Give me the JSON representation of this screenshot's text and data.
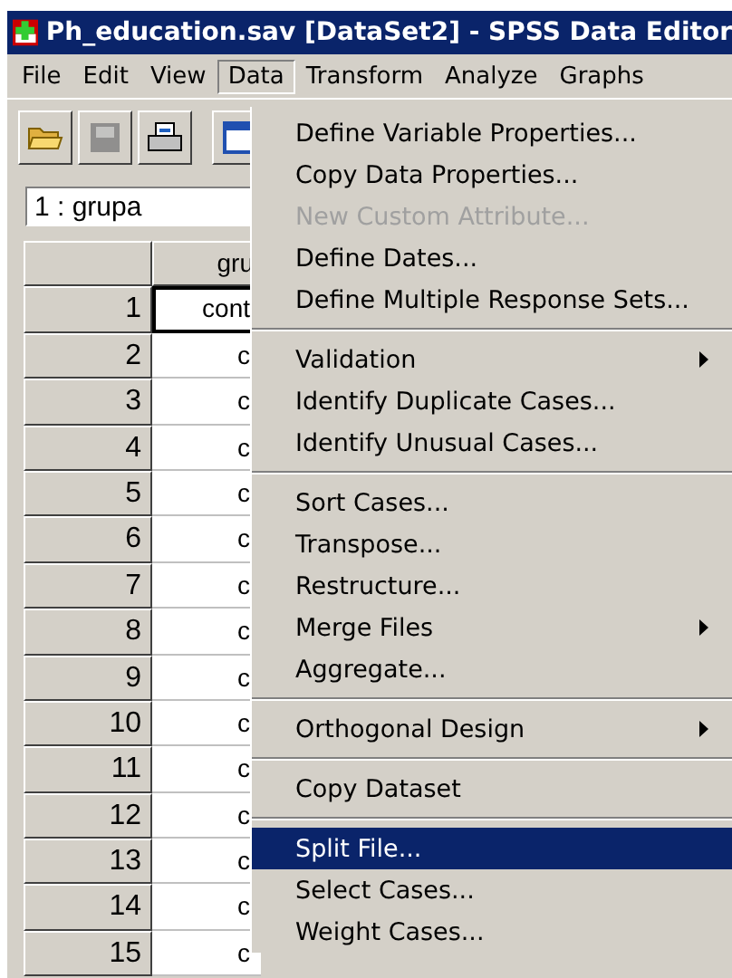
{
  "window": {
    "title": "Ph_education.sav [DataSet2] - SPSS Data Editor"
  },
  "menu_bar": [
    {
      "label": "File",
      "selected": false
    },
    {
      "label": "Edit",
      "selected": false
    },
    {
      "label": "View",
      "selected": false
    },
    {
      "label": "Data",
      "selected": true
    },
    {
      "label": "Transform",
      "selected": false
    },
    {
      "label": "Analyze",
      "selected": false
    },
    {
      "label": "Graphs",
      "selected": false
    }
  ],
  "toolbar": [
    {
      "kind": "open",
      "disabled": false
    },
    {
      "kind": "save",
      "disabled": true
    },
    {
      "kind": "print",
      "disabled": false
    },
    {
      "kind": "dialog",
      "disabled": false
    }
  ],
  "cell_reference": "1 : grupa",
  "grid": {
    "column_header": "gru",
    "rows": [
      {
        "number": "1",
        "value": "cont",
        "selected": true
      },
      {
        "number": "2",
        "value": "c",
        "selected": false
      },
      {
        "number": "3",
        "value": "c",
        "selected": false
      },
      {
        "number": "4",
        "value": "c",
        "selected": false
      },
      {
        "number": "5",
        "value": "c",
        "selected": false
      },
      {
        "number": "6",
        "value": "c",
        "selected": false
      },
      {
        "number": "7",
        "value": "c",
        "selected": false
      },
      {
        "number": "8",
        "value": "c",
        "selected": false
      },
      {
        "number": "9",
        "value": "c",
        "selected": false
      },
      {
        "number": "10",
        "value": "c",
        "selected": false
      },
      {
        "number": "11",
        "value": "c",
        "selected": false
      },
      {
        "number": "12",
        "value": "c",
        "selected": false
      },
      {
        "number": "13",
        "value": "c",
        "selected": false
      },
      {
        "number": "14",
        "value": "c",
        "selected": false
      },
      {
        "number": "15",
        "value": "c",
        "selected": false
      }
    ]
  },
  "data_menu": [
    {
      "kind": "item",
      "label": "Define Variable Properties...",
      "disabled": false,
      "submenu": false,
      "selected": false
    },
    {
      "kind": "item",
      "label": "Copy Data Properties...",
      "disabled": false,
      "submenu": false,
      "selected": false
    },
    {
      "kind": "item",
      "label": "New Custom Attribute...",
      "disabled": true,
      "submenu": false,
      "selected": false
    },
    {
      "kind": "item",
      "label": "Define Dates...",
      "disabled": false,
      "submenu": false,
      "selected": false
    },
    {
      "kind": "item",
      "label": "Define Multiple Response Sets...",
      "disabled": false,
      "submenu": false,
      "selected": false
    },
    {
      "kind": "separator"
    },
    {
      "kind": "item",
      "label": "Validation",
      "disabled": false,
      "submenu": true,
      "selected": false
    },
    {
      "kind": "item",
      "label": "Identify Duplicate Cases...",
      "disabled": false,
      "submenu": false,
      "selected": false
    },
    {
      "kind": "item",
      "label": "Identify Unusual Cases...",
      "disabled": false,
      "submenu": false,
      "selected": false
    },
    {
      "kind": "separator"
    },
    {
      "kind": "item",
      "label": "Sort Cases...",
      "disabled": false,
      "submenu": false,
      "selected": false
    },
    {
      "kind": "item",
      "label": "Transpose...",
      "disabled": false,
      "submenu": false,
      "selected": false
    },
    {
      "kind": "item",
      "label": "Restructure...",
      "disabled": false,
      "submenu": false,
      "selected": false
    },
    {
      "kind": "item",
      "label": "Merge Files",
      "disabled": false,
      "submenu": true,
      "selected": false
    },
    {
      "kind": "item",
      "label": "Aggregate...",
      "disabled": false,
      "submenu": false,
      "selected": false
    },
    {
      "kind": "separator"
    },
    {
      "kind": "item",
      "label": "Orthogonal Design",
      "disabled": false,
      "submenu": true,
      "selected": false
    },
    {
      "kind": "separator"
    },
    {
      "kind": "item",
      "label": "Copy Dataset",
      "disabled": false,
      "submenu": false,
      "selected": false
    },
    {
      "kind": "separator"
    },
    {
      "kind": "item",
      "label": "Split File...",
      "disabled": false,
      "submenu": false,
      "selected": true
    },
    {
      "kind": "item",
      "label": "Select Cases...",
      "disabled": false,
      "submenu": false,
      "selected": false
    },
    {
      "kind": "item",
      "label": "Weight Cases...",
      "disabled": false,
      "submenu": false,
      "selected": false
    }
  ]
}
